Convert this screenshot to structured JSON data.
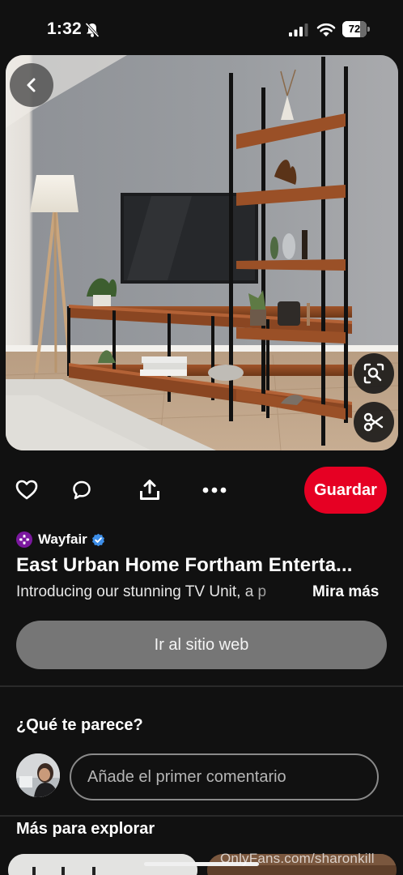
{
  "status_bar": {
    "time": "1:32",
    "battery_percent": 72,
    "battery_label": "72",
    "icons": [
      "bell-slash-icon",
      "signal-icon",
      "wifi-icon",
      "battery-icon"
    ]
  },
  "pin": {
    "image_subject": "tv-unit-shelving-image",
    "back_icon": "chevron-left-icon",
    "lens_icon": "visual-search-icon",
    "crop_icon": "scissors-icon"
  },
  "actions": {
    "icons": [
      "heart-icon",
      "comment-icon",
      "share-icon",
      "more-icon"
    ],
    "save_label": "Guardar",
    "save_color": "#e60023"
  },
  "source": {
    "name": "Wayfair",
    "logo_color": "#7b189f",
    "verified_color": "#3d8ee8"
  },
  "title": "East Urban Home Fortham Enterta...",
  "description": "Introducing our stunning TV Unit, a p",
  "see_more_label": "Mira más",
  "visit_label": "Ir al sitio web",
  "comments": {
    "heading": "¿Qué te parece?",
    "placeholder": "Añade el primer comentario"
  },
  "explore": {
    "heading": "Más para explorar"
  },
  "watermark": "OnlyFans.com/sharonkill"
}
